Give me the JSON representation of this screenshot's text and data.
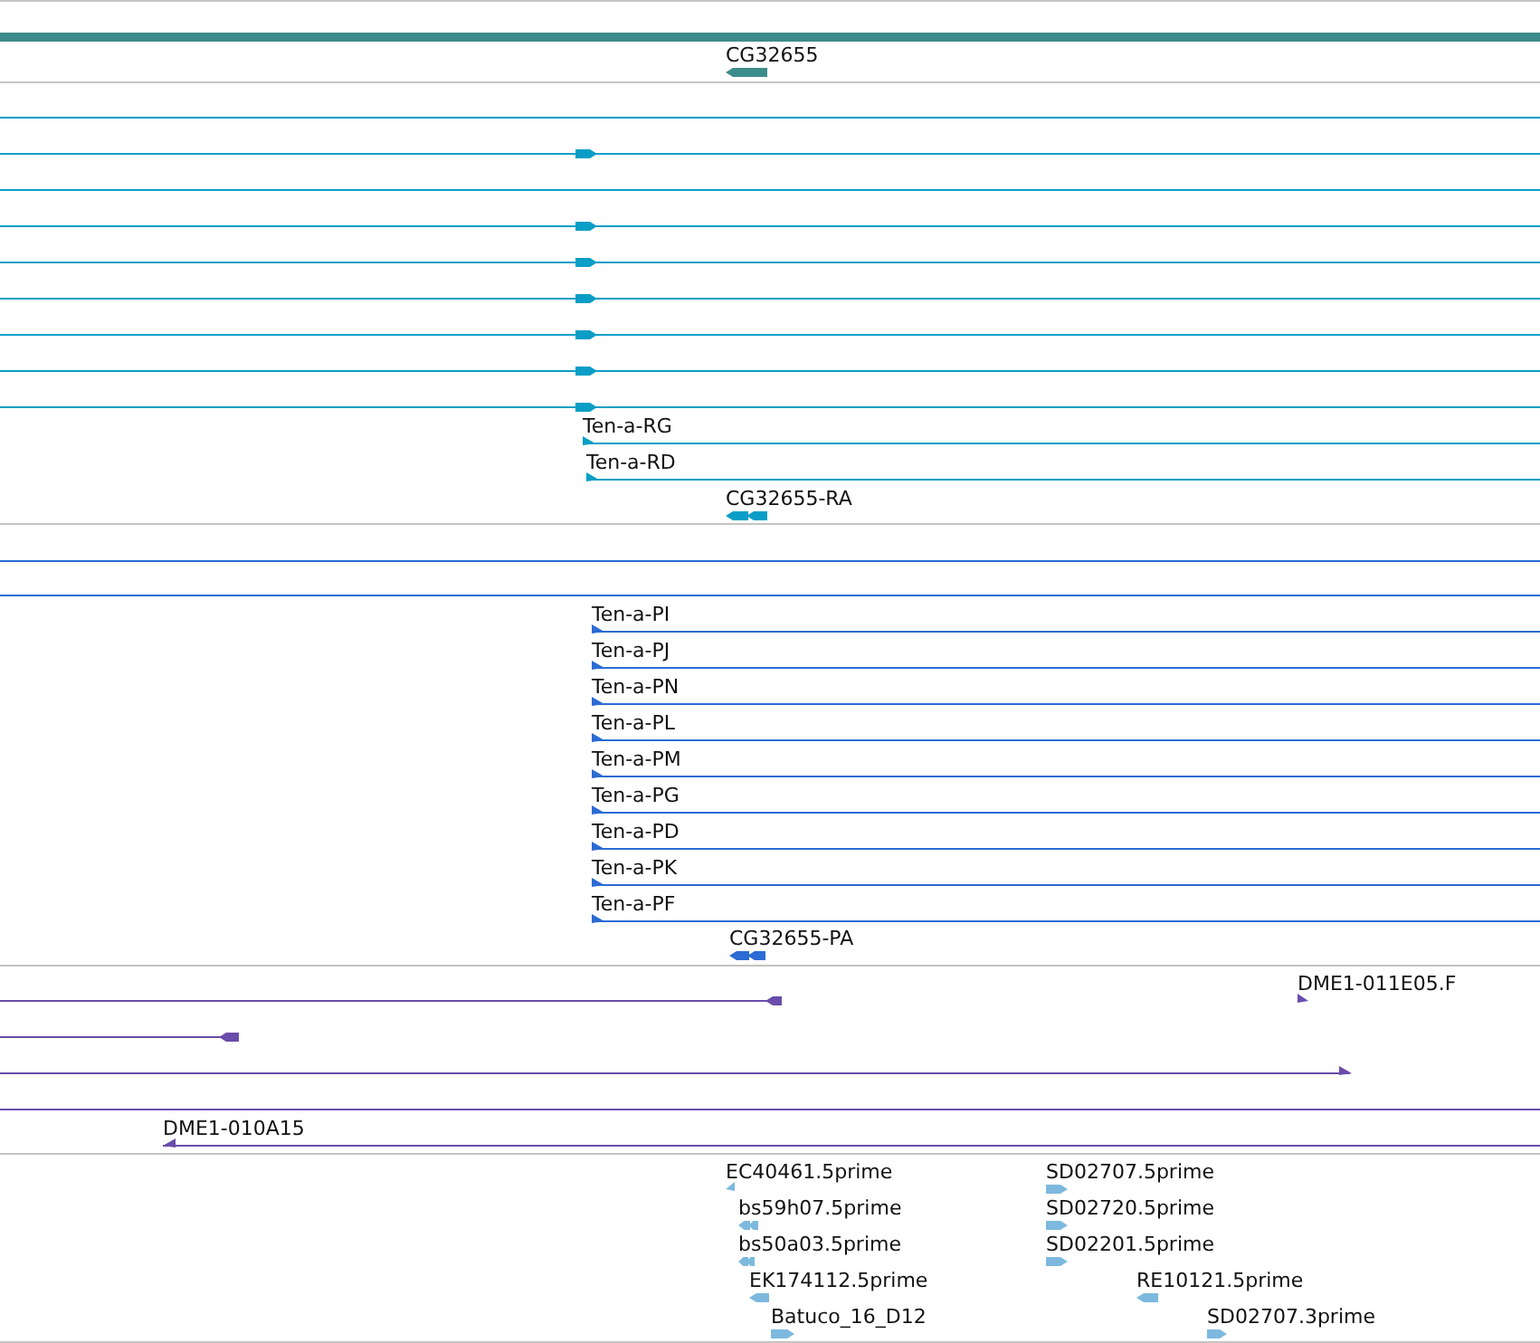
{
  "tracks": [
    {
      "color": "#3d8c8c",
      "features": [
        {
          "kind": "span"
        },
        {
          "kind": "arrow",
          "reverse": true,
          "label": "CG32655"
        }
      ]
    },
    {
      "color": "#0a9ec6",
      "features": [
        {
          "kind": "line"
        },
        {
          "kind": "exon",
          "reverse": false
        },
        {
          "kind": "line"
        },
        {
          "kind": "exon",
          "reverse": false
        },
        {
          "kind": "exon",
          "reverse": false
        },
        {
          "kind": "exon",
          "reverse": false
        },
        {
          "kind": "exon",
          "reverse": false
        },
        {
          "kind": "exon",
          "reverse": false
        },
        {
          "kind": "exon",
          "reverse": false
        },
        {
          "kind": "tick",
          "reverse": false,
          "label": "Ten-a-RG"
        },
        {
          "kind": "tick",
          "reverse": false,
          "label": "Ten-a-RD"
        },
        {
          "kind": "double",
          "reverse": true,
          "label": "CG32655-RA"
        }
      ]
    },
    {
      "color": "#2b6bd4",
      "features": [
        {
          "kind": "line"
        },
        {
          "kind": "line"
        },
        {
          "kind": "tick",
          "reverse": false,
          "label": "Ten-a-PI"
        },
        {
          "kind": "tick",
          "reverse": false,
          "label": "Ten-a-PJ"
        },
        {
          "kind": "tick",
          "reverse": false,
          "label": "Ten-a-PN"
        },
        {
          "kind": "tick",
          "reverse": false,
          "label": "Ten-a-PL"
        },
        {
          "kind": "tick",
          "reverse": false,
          "label": "Ten-a-PM"
        },
        {
          "kind": "tick",
          "reverse": false,
          "label": "Ten-a-PG"
        },
        {
          "kind": "tick",
          "reverse": false,
          "label": "Ten-a-PD"
        },
        {
          "kind": "tick",
          "reverse": false,
          "label": "Ten-a-PK"
        },
        {
          "kind": "tick",
          "reverse": false,
          "label": "Ten-a-PF"
        },
        {
          "kind": "double",
          "reverse": true,
          "label": "CG32655-PA"
        }
      ]
    },
    {
      "color": "#6a4caa",
      "features": [
        {
          "kind": "cap",
          "reverse": true
        },
        {
          "kind": "tick",
          "reverse": false,
          "label": "DME1-011E05.F"
        },
        {
          "kind": "cap",
          "reverse": true
        },
        {
          "kind": "tick",
          "reverse": false
        },
        {
          "kind": "line"
        },
        {
          "kind": "tick",
          "reverse": true,
          "label": "DME1-010A15"
        }
      ]
    },
    {
      "color": "#7db9de",
      "features": [
        {
          "kind": "tick",
          "reverse": true,
          "label": "EC40461.5prime"
        },
        {
          "kind": "double",
          "reverse": true,
          "label": "bs59h07.5prime"
        },
        {
          "kind": "double",
          "reverse": true,
          "label": "bs50a03.5prime"
        },
        {
          "kind": "arrow",
          "reverse": true,
          "label": "EK174112.5prime"
        },
        {
          "kind": "arrow",
          "reverse": false,
          "label": "Batuco_16_D12"
        },
        {
          "kind": "arrow",
          "reverse": false,
          "label": "SD02707.5prime"
        },
        {
          "kind": "arrow",
          "reverse": false,
          "label": "SD02720.5prime"
        },
        {
          "kind": "arrow",
          "reverse": false,
          "label": "SD02201.5prime"
        },
        {
          "kind": "arrow",
          "reverse": true,
          "label": "RE10121.5prime"
        },
        {
          "kind": "arrow",
          "reverse": false,
          "label": "SD02707.3prime"
        }
      ]
    }
  ]
}
